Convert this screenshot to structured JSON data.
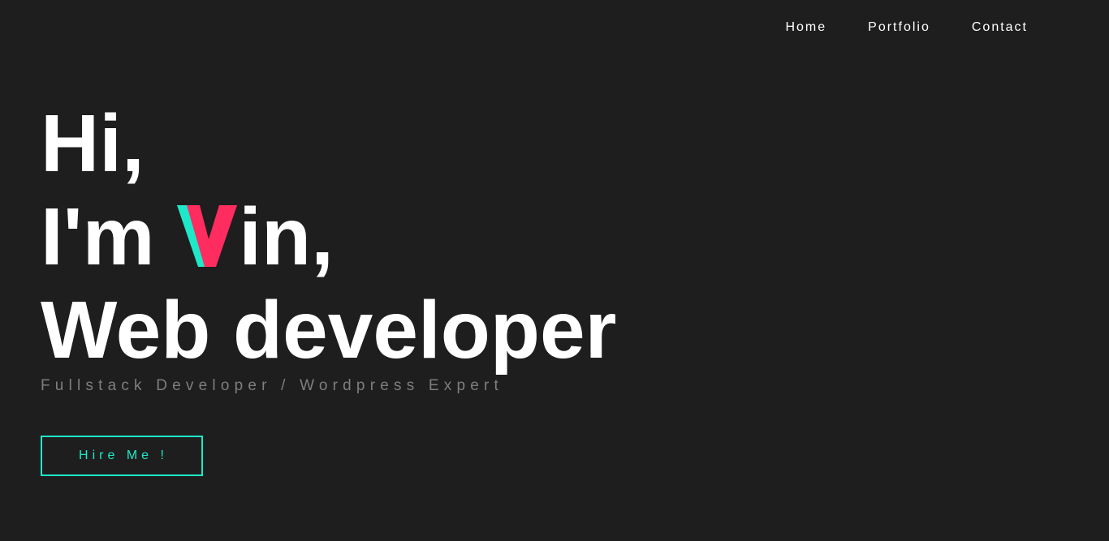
{
  "nav": {
    "items": [
      {
        "label": "Home"
      },
      {
        "label": "Portfolio"
      },
      {
        "label": "Contact"
      }
    ]
  },
  "hero": {
    "line1": "Hi,",
    "line2_prefix": "I'm ",
    "line2_logo_letter": "V",
    "line2_suffix": "in,",
    "line3": "Web developer",
    "subtitle": "Fullstack Developer / Wordpress Expert"
  },
  "cta": {
    "label": "Hire Me !"
  },
  "colors": {
    "background": "#1e1e1e",
    "text": "#ffffff",
    "subtitle": "#7e7e7e",
    "accent_teal": "#1de9c9",
    "accent_pink": "#ff2d5f"
  }
}
